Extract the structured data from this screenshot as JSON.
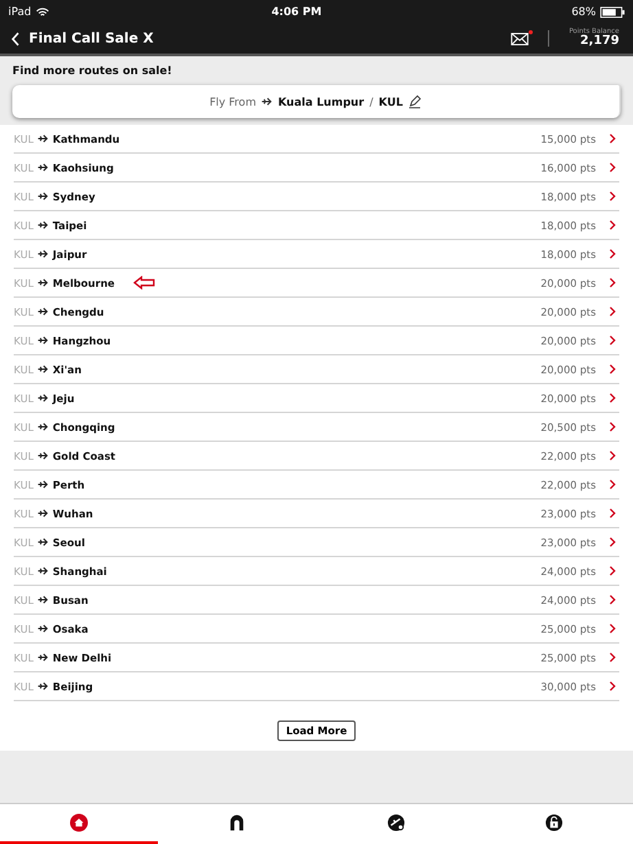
{
  "status_bar": {
    "device": "iPad",
    "time": "4:06 PM",
    "battery": "68%"
  },
  "header": {
    "title": "Final Call Sale X",
    "unread_messages": true,
    "points_label": "Points Balance",
    "points": "2,179"
  },
  "intro": "Find more routes on sale!",
  "origin": {
    "label": "Fly From",
    "city": "Kuala Lumpur",
    "separator": "/",
    "code": "KUL"
  },
  "routes": [
    {
      "from": "KUL",
      "to": "Kathmandu",
      "price": "15,000 pts",
      "marked": false
    },
    {
      "from": "KUL",
      "to": "Kaohsiung",
      "price": "16,000 pts",
      "marked": false
    },
    {
      "from": "KUL",
      "to": "Sydney",
      "price": "18,000 pts",
      "marked": false
    },
    {
      "from": "KUL",
      "to": "Taipei",
      "price": "18,000 pts",
      "marked": false
    },
    {
      "from": "KUL",
      "to": "Jaipur",
      "price": "18,000 pts",
      "marked": false
    },
    {
      "from": "KUL",
      "to": "Melbourne",
      "price": "20,000 pts",
      "marked": true
    },
    {
      "from": "KUL",
      "to": "Chengdu",
      "price": "20,000 pts",
      "marked": false
    },
    {
      "from": "KUL",
      "to": "Hangzhou",
      "price": "20,000 pts",
      "marked": false
    },
    {
      "from": "KUL",
      "to": "Xi'an",
      "price": "20,000 pts",
      "marked": false
    },
    {
      "from": "KUL",
      "to": "Jeju",
      "price": "20,000 pts",
      "marked": false
    },
    {
      "from": "KUL",
      "to": "Chongqing",
      "price": "20,500 pts",
      "marked": false
    },
    {
      "from": "KUL",
      "to": "Gold Coast",
      "price": "22,000 pts",
      "marked": false
    },
    {
      "from": "KUL",
      "to": "Perth",
      "price": "22,000 pts",
      "marked": false
    },
    {
      "from": "KUL",
      "to": "Wuhan",
      "price": "23,000 pts",
      "marked": false
    },
    {
      "from": "KUL",
      "to": "Seoul",
      "price": "23,000 pts",
      "marked": false
    },
    {
      "from": "KUL",
      "to": "Shanghai",
      "price": "24,000 pts",
      "marked": false
    },
    {
      "from": "KUL",
      "to": "Busan",
      "price": "24,000 pts",
      "marked": false
    },
    {
      "from": "KUL",
      "to": "Osaka",
      "price": "25,000 pts",
      "marked": false
    },
    {
      "from": "KUL",
      "to": "New Delhi",
      "price": "25,000 pts",
      "marked": false
    },
    {
      "from": "KUL",
      "to": "Beijing",
      "price": "30,000 pts",
      "marked": false
    }
  ],
  "load_more": "Load More",
  "tabs": [
    {
      "kind": "home",
      "selected": true
    },
    {
      "kind": "profile",
      "selected": false
    },
    {
      "kind": "flight-search",
      "selected": false
    },
    {
      "kind": "lock",
      "selected": false
    }
  ]
}
